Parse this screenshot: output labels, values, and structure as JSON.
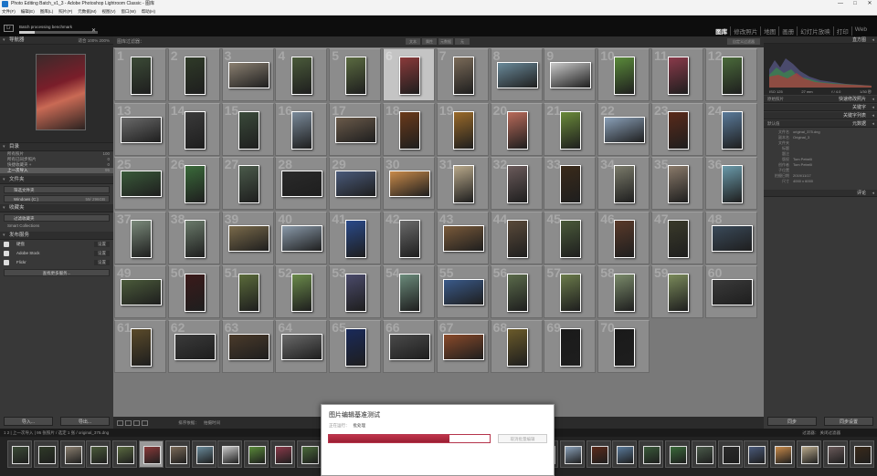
{
  "window": {
    "title": "Photo Editing Batch_v1_3 - Adobe Photoshop Lightroom Classic - 图库",
    "controls": [
      "—",
      "□",
      "✕"
    ]
  },
  "menu": [
    "文件(F)",
    "编辑(E)",
    "图库(L)",
    "照片(P)",
    "元数据(M)",
    "视图(V)",
    "窗口(W)",
    "帮助(H)"
  ],
  "identity": {
    "logo": "Lr",
    "batch_text": "Batch processing benchmark",
    "batch_progress": 0.2,
    "close": "✕"
  },
  "modules": [
    "图库",
    "修改照片",
    "地图",
    "画册",
    "幻灯片放映",
    "打印",
    "Web"
  ],
  "left": {
    "navigator": "导航器",
    "nav_opts": "适合 100% 200%",
    "catalog": "目录",
    "catalog_items": [
      {
        "label": "所有照片",
        "count": "100"
      },
      {
        "label": "所有已同步照片",
        "count": "0"
      },
      {
        "label": "快捷收藏夹 +",
        "count": "0"
      },
      {
        "label": "上一次导入",
        "count": "95"
      }
    ],
    "folders": "文件夹",
    "folder_search": "筛选文件夹",
    "volume": "Windows (C:)",
    "volume_info": "59/ 296GB",
    "collections": "收藏夹",
    "collection_search": "过滤收藏夹",
    "smart": "Smart Collections",
    "publish": "发布服务",
    "services": [
      {
        "label": "硬盘"
      },
      {
        "label": "Adobe Stock"
      },
      {
        "label": "Flickr"
      }
    ],
    "services_set": "设置",
    "find_more": "查找更多服务...",
    "import": "导入...",
    "export": "导出..."
  },
  "grid_top": {
    "label": "图库过滤器：",
    "filters": [
      "文本",
      "属性",
      "元数据",
      "无"
    ],
    "custom": "自定义过滤器"
  },
  "grid": [
    {
      "n": "1",
      "o": "v",
      "c": "#3b4a36"
    },
    {
      "n": "2",
      "o": "v",
      "c": "#2f3a28"
    },
    {
      "n": "3",
      "o": "h",
      "c": "#8a7f70"
    },
    {
      "n": "4",
      "o": "v",
      "c": "#4a5a3a"
    },
    {
      "n": "5",
      "o": "v",
      "c": "#5a6a40"
    },
    {
      "n": "6",
      "o": "v",
      "c": "#8a3a3a"
    },
    {
      "n": "7",
      "o": "v",
      "c": "#7a6a58"
    },
    {
      "n": "8",
      "o": "h",
      "c": "#6a8a9a"
    },
    {
      "n": "9",
      "o": "h",
      "c": "#c8c8c8"
    },
    {
      "n": "10",
      "o": "v",
      "c": "#5a8a3a"
    },
    {
      "n": "11",
      "o": "v",
      "c": "#8a3a4a"
    },
    {
      "n": "12",
      "o": "v",
      "c": "#4a6a3a"
    },
    {
      "n": "13",
      "o": "h",
      "c": "#6a6a6a"
    },
    {
      "n": "14",
      "o": "v",
      "c": "#3a3a3a"
    },
    {
      "n": "15",
      "o": "v",
      "c": "#3a4a3a"
    },
    {
      "n": "16",
      "o": "v",
      "c": "#7a8a9a"
    },
    {
      "n": "17",
      "o": "h",
      "c": "#6a5a4a"
    },
    {
      "n": "18",
      "o": "v",
      "c": "#6a3a1a"
    },
    {
      "n": "19",
      "o": "v",
      "c": "#9a6a2a"
    },
    {
      "n": "20",
      "o": "v",
      "c": "#b86a5a"
    },
    {
      "n": "21",
      "o": "v",
      "c": "#6a8a3a"
    },
    {
      "n": "22",
      "o": "h",
      "c": "#8aa0b8"
    },
    {
      "n": "23",
      "o": "v",
      "c": "#5a2a1a"
    },
    {
      "n": "24",
      "o": "v",
      "c": "#5a7a9a"
    },
    {
      "n": "25",
      "o": "h",
      "c": "#3a5a3a"
    },
    {
      "n": "26",
      "o": "v",
      "c": "#3a6a3a"
    },
    {
      "n": "27",
      "o": "v",
      "c": "#4a5a4a"
    },
    {
      "n": "28",
      "o": "h",
      "c": "#2a2a2a"
    },
    {
      "n": "29",
      "o": "h",
      "c": "#4a5a7a"
    },
    {
      "n": "30",
      "o": "h",
      "c": "#c88a4a"
    },
    {
      "n": "31",
      "o": "v",
      "c": "#b8a88a"
    },
    {
      "n": "32",
      "o": "v",
      "c": "#6a5a5a"
    },
    {
      "n": "33",
      "o": "v",
      "c": "#3a2a1a"
    },
    {
      "n": "34",
      "o": "v",
      "c": "#7a7a6a"
    },
    {
      "n": "35",
      "o": "v",
      "c": "#8a7a6a"
    },
    {
      "n": "36",
      "o": "v",
      "c": "#6a9aaa"
    },
    {
      "n": "37",
      "o": "v",
      "c": "#7a8a7a"
    },
    {
      "n": "38",
      "o": "v",
      "c": "#6a7a6a"
    },
    {
      "n": "39",
      "o": "h",
      "c": "#7a6a4a"
    },
    {
      "n": "40",
      "o": "h",
      "c": "#8a9aaa"
    },
    {
      "n": "41",
      "o": "v",
      "c": "#2a4a8a"
    },
    {
      "n": "42",
      "o": "v",
      "c": "#6a6a6a"
    },
    {
      "n": "43",
      "o": "h",
      "c": "#7a5a3a"
    },
    {
      "n": "44",
      "o": "v",
      "c": "#5a4a3a"
    },
    {
      "n": "45",
      "o": "v",
      "c": "#4a5a3a"
    },
    {
      "n": "46",
      "o": "v",
      "c": "#5a3a2a"
    },
    {
      "n": "47",
      "o": "v",
      "c": "#3a3a2a"
    },
    {
      "n": "48",
      "o": "h",
      "c": "#3a4a5a"
    },
    {
      "n": "49",
      "o": "h",
      "c": "#4a5a3a"
    },
    {
      "n": "50",
      "o": "v",
      "c": "#3a1a1a"
    },
    {
      "n": "51",
      "o": "v",
      "c": "#5a6a3a"
    },
    {
      "n": "52",
      "o": "v",
      "c": "#6a8a4a"
    },
    {
      "n": "53",
      "o": "v",
      "c": "#4a4a6a"
    },
    {
      "n": "54",
      "o": "v",
      "c": "#6a8a7a"
    },
    {
      "n": "55",
      "o": "h",
      "c": "#3a5a8a"
    },
    {
      "n": "56",
      "o": "v",
      "c": "#5a6a4a"
    },
    {
      "n": "57",
      "o": "v",
      "c": "#6a7a4a"
    },
    {
      "n": "58",
      "o": "v",
      "c": "#7a8a6a"
    },
    {
      "n": "59",
      "o": "v",
      "c": "#7a8a5a"
    },
    {
      "n": "60",
      "o": "h",
      "c": "#3a3a3a"
    },
    {
      "n": "61",
      "o": "v",
      "c": "#5a4a2a"
    },
    {
      "n": "62",
      "o": "h",
      "c": "#3a3a3a"
    },
    {
      "n": "63",
      "o": "h",
      "c": "#4a3a2a"
    },
    {
      "n": "64",
      "o": "h",
      "c": "#6a6a6a"
    },
    {
      "n": "65",
      "o": "v",
      "c": "#1a2a5a"
    },
    {
      "n": "66",
      "o": "h",
      "c": "#4a4a4a"
    },
    {
      "n": "67",
      "o": "h",
      "c": "#8a4a2a"
    },
    {
      "n": "68",
      "o": "v",
      "c": "#6a5a2a"
    },
    {
      "n": "69",
      "o": "v",
      "c": "#1a1a1a"
    },
    {
      "n": "70",
      "o": "v",
      "c": "#1a1a1a"
    }
  ],
  "toolbar": {
    "sort_label": "排序依据：",
    "sort": "拍摄时间"
  },
  "filmstrip": {
    "label": "1  2  | 上一次导入  | 95 张照片 / 选定 1 张 / original_375.dng",
    "filter": "过滤器：",
    "filter_value": "关闭过滤器"
  },
  "right": {
    "histogram": "直方图",
    "hist_info": [
      "ISO 125",
      "27 mm",
      "f / 4.0",
      "1/30 秒"
    ],
    "original": "原始照片",
    "quick": "快速修改照片",
    "keywords": "关键字",
    "keyword_list": "关键字列表",
    "metadata": "元数据",
    "meta_preset": "默认值",
    "meta_fields": [
      {
        "k": "文件名",
        "v": "original_375.dng"
      },
      {
        "k": "副本名",
        "v": "Original_3"
      },
      {
        "k": "文件夹",
        "v": ""
      },
      {
        "k": "标题",
        "v": ""
      },
      {
        "k": "题注",
        "v": ""
      },
      {
        "k": "版权",
        "v": "Tom Petrelli"
      },
      {
        "k": "创作者",
        "v": "Tom Petrelli"
      },
      {
        "k": "子位置",
        "v": ""
      },
      {
        "k": "拍摄日期",
        "v": "2019/11/17"
      },
      {
        "k": "尺寸",
        "v": "4000 x 6000"
      }
    ],
    "comments": "评论",
    "sync": "同步",
    "sync_settings": "同步设置"
  },
  "dialog": {
    "title": "图片编辑基准测试",
    "sub_label": "正在运行：",
    "sub_value": "批处理",
    "progress": 0.75,
    "cancel": "取消批量编辑"
  }
}
